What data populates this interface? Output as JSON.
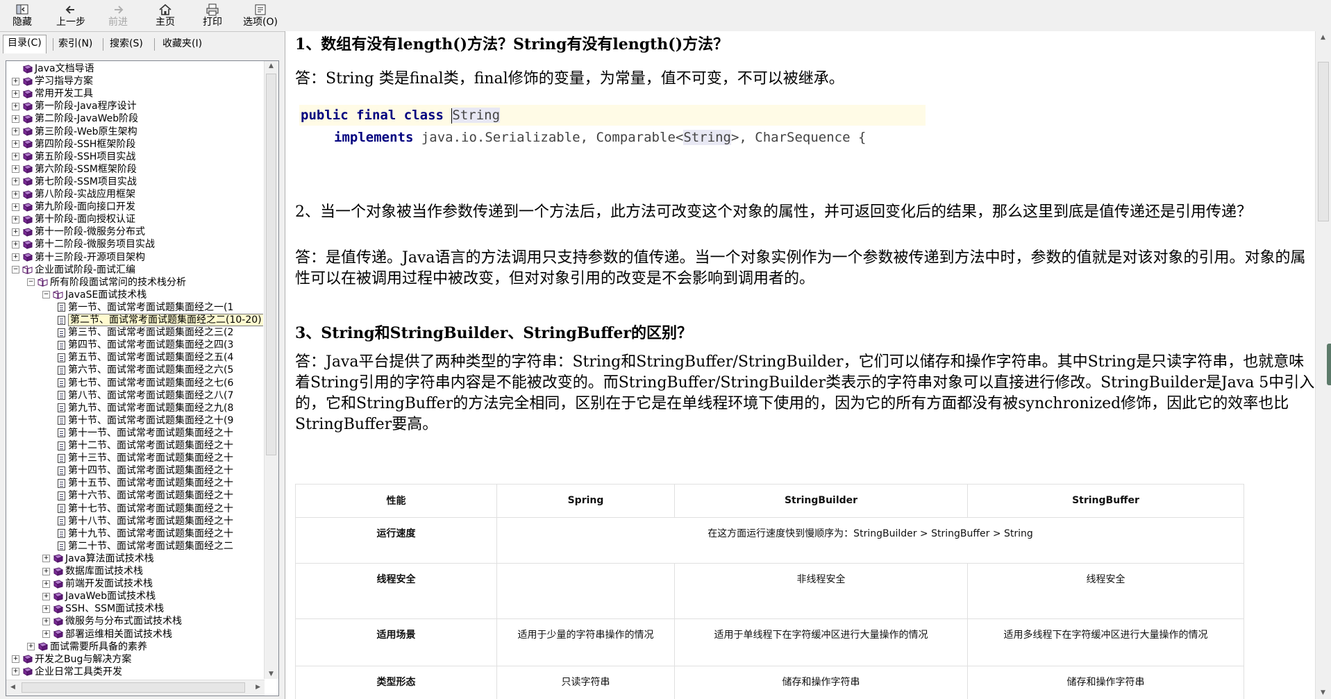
{
  "toolbar": {
    "hide": "隐藏",
    "back": "上一步",
    "forward": "前进",
    "home": "主页",
    "print": "打印",
    "options": "选项(O)"
  },
  "nav_tabs": [
    "目录(C)",
    "索引(N)",
    "搜索(S)",
    "收藏夹(I)"
  ],
  "tree": [
    {
      "level": 0,
      "expander": "",
      "icon": "book",
      "label": "Java文档导语"
    },
    {
      "level": 0,
      "expander": "+",
      "icon": "book",
      "label": "学习指导方案"
    },
    {
      "level": 0,
      "expander": "+",
      "icon": "book",
      "label": "常用开发工具"
    },
    {
      "level": 0,
      "expander": "+",
      "icon": "book",
      "label": "第一阶段-Java程序设计"
    },
    {
      "level": 0,
      "expander": "+",
      "icon": "book",
      "label": "第二阶段-JavaWeb阶段"
    },
    {
      "level": 0,
      "expander": "+",
      "icon": "book",
      "label": "第三阶段-Web原生架构"
    },
    {
      "level": 0,
      "expander": "+",
      "icon": "book",
      "label": "第四阶段-SSH框架阶段"
    },
    {
      "level": 0,
      "expander": "+",
      "icon": "book",
      "label": "第五阶段-SSH项目实战"
    },
    {
      "level": 0,
      "expander": "+",
      "icon": "book",
      "label": "第六阶段-SSM框架阶段"
    },
    {
      "level": 0,
      "expander": "+",
      "icon": "book",
      "label": "第七阶段-SSM项目实战"
    },
    {
      "level": 0,
      "expander": "+",
      "icon": "book",
      "label": "第八阶段-实战应用框架"
    },
    {
      "level": 0,
      "expander": "+",
      "icon": "book",
      "label": "第九阶段-面向接口开发"
    },
    {
      "level": 0,
      "expander": "+",
      "icon": "book",
      "label": "第十阶段-面向授权认证"
    },
    {
      "level": 0,
      "expander": "+",
      "icon": "book",
      "label": "第十一阶段-微服务分布式"
    },
    {
      "level": 0,
      "expander": "+",
      "icon": "book",
      "label": "第十二阶段-微服务项目实战"
    },
    {
      "level": 0,
      "expander": "+",
      "icon": "book",
      "label": "第十三阶段-开源项目架构"
    },
    {
      "level": 0,
      "expander": "-",
      "icon": "book-open",
      "label": "企业面试阶段-面试汇编"
    },
    {
      "level": 1,
      "expander": "-",
      "icon": "book-open",
      "label": "所有阶段面试常问的技术栈分析"
    },
    {
      "level": 2,
      "expander": "-",
      "icon": "book-open",
      "label": "JavaSE面试技术栈"
    },
    {
      "level": 3,
      "expander": "",
      "icon": "page",
      "label": "第一节、面试常考面试题集面经之一(1"
    },
    {
      "level": 3,
      "expander": "",
      "icon": "page",
      "label": "第二节、面试常考面试题集面经之二(10-20)",
      "selected": true
    },
    {
      "level": 3,
      "expander": "",
      "icon": "page",
      "label": "第三节、面试常考面试题集面经之三(2"
    },
    {
      "level": 3,
      "expander": "",
      "icon": "page",
      "label": "第四节、面试常考面试题集面经之四(3"
    },
    {
      "level": 3,
      "expander": "",
      "icon": "page",
      "label": "第五节、面试常考面试题集面经之五(4"
    },
    {
      "level": 3,
      "expander": "",
      "icon": "page",
      "label": "第六节、面试常考面试题集面经之六(5"
    },
    {
      "level": 3,
      "expander": "",
      "icon": "page",
      "label": "第七节、面试常考面试题集面经之七(6"
    },
    {
      "level": 3,
      "expander": "",
      "icon": "page",
      "label": "第八节、面试常考面试题集面经之八(7"
    },
    {
      "level": 3,
      "expander": "",
      "icon": "page",
      "label": "第九节、面试常考面试题集面经之九(8"
    },
    {
      "level": 3,
      "expander": "",
      "icon": "page",
      "label": "第十节、面试常考面试题集面经之十(9"
    },
    {
      "level": 3,
      "expander": "",
      "icon": "page",
      "label": "第十一节、面试常考面试题集面经之十"
    },
    {
      "level": 3,
      "expander": "",
      "icon": "page",
      "label": "第十二节、面试常考面试题集面经之十"
    },
    {
      "level": 3,
      "expander": "",
      "icon": "page",
      "label": "第十三节、面试常考面试题集面经之十"
    },
    {
      "level": 3,
      "expander": "",
      "icon": "page",
      "label": "第十四节、面试常考面试题集面经之十"
    },
    {
      "level": 3,
      "expander": "",
      "icon": "page",
      "label": "第十五节、面试常考面试题集面经之十"
    },
    {
      "level": 3,
      "expander": "",
      "icon": "page",
      "label": "第十六节、面试常考面试题集面经之十"
    },
    {
      "level": 3,
      "expander": "",
      "icon": "page",
      "label": "第十七节、面试常考面试题集面经之十"
    },
    {
      "level": 3,
      "expander": "",
      "icon": "page",
      "label": "第十八节、面试常考面试题集面经之十"
    },
    {
      "level": 3,
      "expander": "",
      "icon": "page",
      "label": "第十九节、面试常考面试题集面经之十"
    },
    {
      "level": 3,
      "expander": "",
      "icon": "page",
      "label": "第二十节、面试常考面试题集面经之二"
    },
    {
      "level": 2,
      "expander": "+",
      "icon": "book",
      "label": "Java算法面试技术栈"
    },
    {
      "level": 2,
      "expander": "+",
      "icon": "book",
      "label": "数据库面试技术栈"
    },
    {
      "level": 2,
      "expander": "+",
      "icon": "book",
      "label": "前端开发面试技术栈"
    },
    {
      "level": 2,
      "expander": "+",
      "icon": "book",
      "label": "JavaWeb面试技术栈"
    },
    {
      "level": 2,
      "expander": "+",
      "icon": "book",
      "label": "SSH、SSM面试技术栈"
    },
    {
      "level": 2,
      "expander": "+",
      "icon": "book",
      "label": "微服务与分布式面试技术栈"
    },
    {
      "level": 2,
      "expander": "+",
      "icon": "book",
      "label": "部署运维相关面试技术栈"
    },
    {
      "level": 1,
      "expander": "+",
      "icon": "book",
      "label": "面试需要所具备的素养"
    },
    {
      "level": 0,
      "expander": "+",
      "icon": "book",
      "label": "开发之Bug与解决方案"
    },
    {
      "level": 0,
      "expander": "+",
      "icon": "book",
      "label": "企业日常工具类开发"
    }
  ],
  "content": {
    "q1": "1、数组有没有length()方法？String有没有length()方法？",
    "a1": "答：String 类是final类，final修饰的变量，为常量，值不可变，不可以被继承。",
    "code": {
      "kw_public": "public",
      "kw_final": "final",
      "kw_class": "class",
      "class_name": "String",
      "kw_implements": "implements",
      "impl_a": " java.io.Serializable, Comparable<",
      "impl_b": "String",
      "impl_c": ">, CharSequence {"
    },
    "q2": "2、当一个对象被当作参数传递到一个方法后，此方法可改变这个对象的属性，并可返回变化后的结果，那么这里到底是值传递还是引用传递？",
    "a2": "答：是值传递。Java语言的方法调用只支持参数的值传递。当一个对象实例作为一个参数被传递到方法中时，参数的值就是对该对象的引用。对象的属性可以在被调用过程中被改变，但对对象引用的改变是不会影响到调用者的。",
    "q3": "3、String和StringBuilder、StringBuffer的区别？",
    "a3": "答：Java平台提供了两种类型的字符串：String和StringBuffer/StringBuilder，它们可以储存和操作字符串。其中String是只读字符串，也就意味着String引用的字符串内容是不能被改变的。而StringBuffer/StringBuilder类表示的字符串对象可以直接进行修改。StringBuilder是Java 5中引入的，它和StringBuffer的方法完全相同，区别在于它是在单线程环境下使用的，因为它的所有方面都没有被synchronized修饰，因此它的效率也比StringBuffer要高。",
    "table": {
      "headers": [
        "性能",
        "Spring",
        "StringBuilder",
        "StringBuffer"
      ],
      "rows": [
        {
          "label": "运行速度",
          "merged": "在这方面运行速度快到慢顺序为：StringBuilder > StringBuffer > String"
        },
        {
          "label": "线程安全",
          "cells": [
            "",
            "非线程安全",
            "线程安全"
          ]
        },
        {
          "label": "适用场景",
          "cells": [
            "适用于少量的字符串操作的情况",
            "适用于单线程下在字符缓冲区进行大量操作的情况",
            "适用多线程下在字符缓冲区进行大量操作的情况"
          ]
        },
        {
          "label": "类型形态",
          "cells": [
            "只读字符串",
            "储存和操作字符串",
            "储存和操作字符串"
          ]
        }
      ]
    }
  }
}
